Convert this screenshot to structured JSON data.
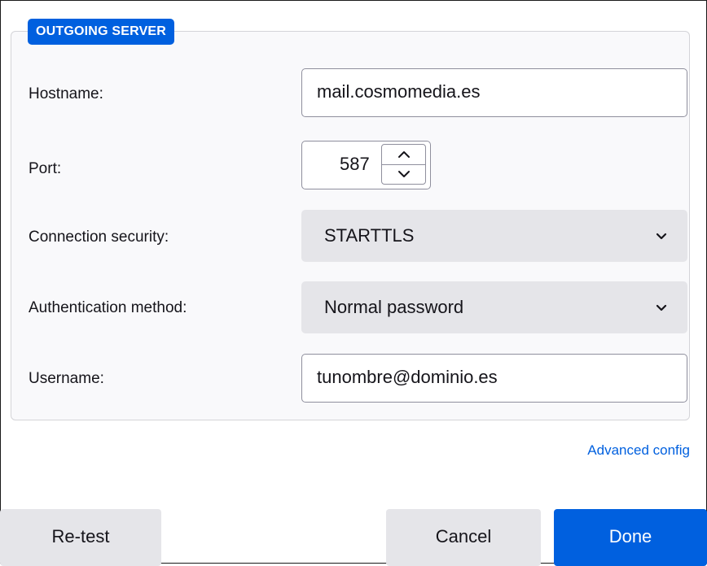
{
  "section": {
    "legend": "OUTGOING SERVER"
  },
  "fields": {
    "hostname": {
      "label": "Hostname:",
      "value": "mail.cosmomedia.es"
    },
    "port": {
      "label": "Port:",
      "value": "587"
    },
    "connection_security": {
      "label": "Connection security:",
      "value": "STARTTLS"
    },
    "authentication_method": {
      "label": "Authentication method:",
      "value": "Normal password"
    },
    "username": {
      "label": "Username:",
      "value": "tunombre@dominio.es"
    }
  },
  "links": {
    "advanced_config": "Advanced config"
  },
  "buttons": {
    "retest": "Re-test",
    "cancel": "Cancel",
    "done": "Done"
  },
  "icons": {
    "spin_up": "chevron-up-icon",
    "spin_down": "chevron-down-icon",
    "dropdown": "chevron-down-icon"
  },
  "colors": {
    "accent": "#0060df",
    "button_gray": "#e5e5e9",
    "field_border": "#8f8f9d"
  }
}
